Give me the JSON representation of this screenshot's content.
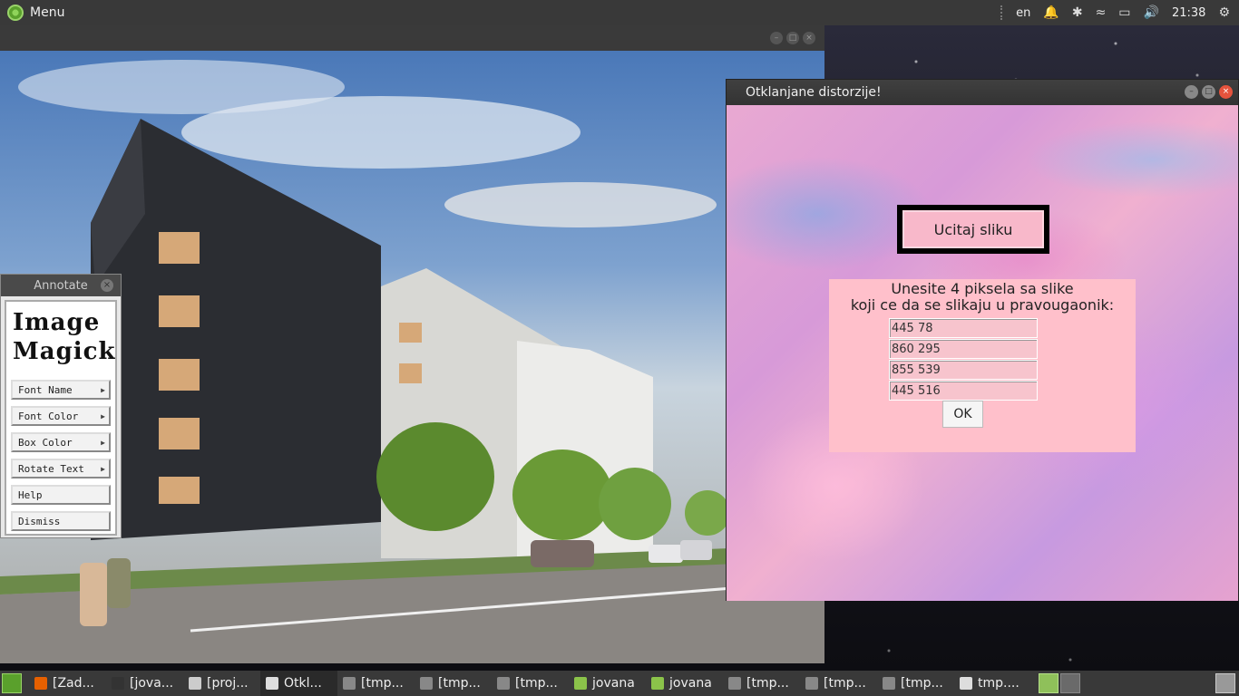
{
  "top_panel": {
    "menu_label": "Menu",
    "keyboard_layout": "en",
    "clock": "21:38",
    "icons": [
      "notification-bell-icon",
      "bluetooth-icon",
      "wifi-icon",
      "battery-icon",
      "volume-icon",
      "settings-gear-icon"
    ]
  },
  "annotate": {
    "title": "Annotate",
    "logo_line1": "Image",
    "logo_line2": "Magick",
    "buttons": [
      "Font Name",
      "Font Color",
      "Box Color",
      "Rotate Text",
      "Help",
      "Dismiss"
    ]
  },
  "app": {
    "title": "Otklanjane distorzije!",
    "load_button": "Ucitaj sliku",
    "prompt_line1": "Unesite 4 piksela sa slike",
    "prompt_line2": "koji ce da se slikaju u pravougaonik:",
    "inputs": [
      "445 78",
      "860 295",
      "855 539",
      "445 516"
    ],
    "ok_button": "OK"
  },
  "taskbar": {
    "tasks": [
      {
        "label": "[Zad...",
        "icon": "firefox-icon",
        "color": "#e66000"
      },
      {
        "label": "[jova...",
        "icon": "terminal-icon",
        "color": "#333333"
      },
      {
        "label": "[proj...",
        "icon": "text-editor-icon",
        "color": "#cccccc"
      },
      {
        "label": "Otkl...",
        "icon": "window-icon",
        "color": "#dddddd"
      },
      {
        "label": "[tmp...",
        "icon": "window-icon",
        "color": "#888888"
      },
      {
        "label": "[tmp...",
        "icon": "window-icon",
        "color": "#888888"
      },
      {
        "label": "[tmp...",
        "icon": "window-icon",
        "color": "#888888"
      },
      {
        "label": "jovana",
        "icon": "folder-icon",
        "color": "#8bc34a"
      },
      {
        "label": "jovana",
        "icon": "folder-icon",
        "color": "#8bc34a"
      },
      {
        "label": "[tmp...",
        "icon": "window-icon",
        "color": "#888888"
      },
      {
        "label": "[tmp...",
        "icon": "window-icon",
        "color": "#888888"
      },
      {
        "label": "[tmp...",
        "icon": "window-icon",
        "color": "#888888"
      },
      {
        "label": "tmp....",
        "icon": "window-icon",
        "color": "#dddddd"
      }
    ]
  }
}
